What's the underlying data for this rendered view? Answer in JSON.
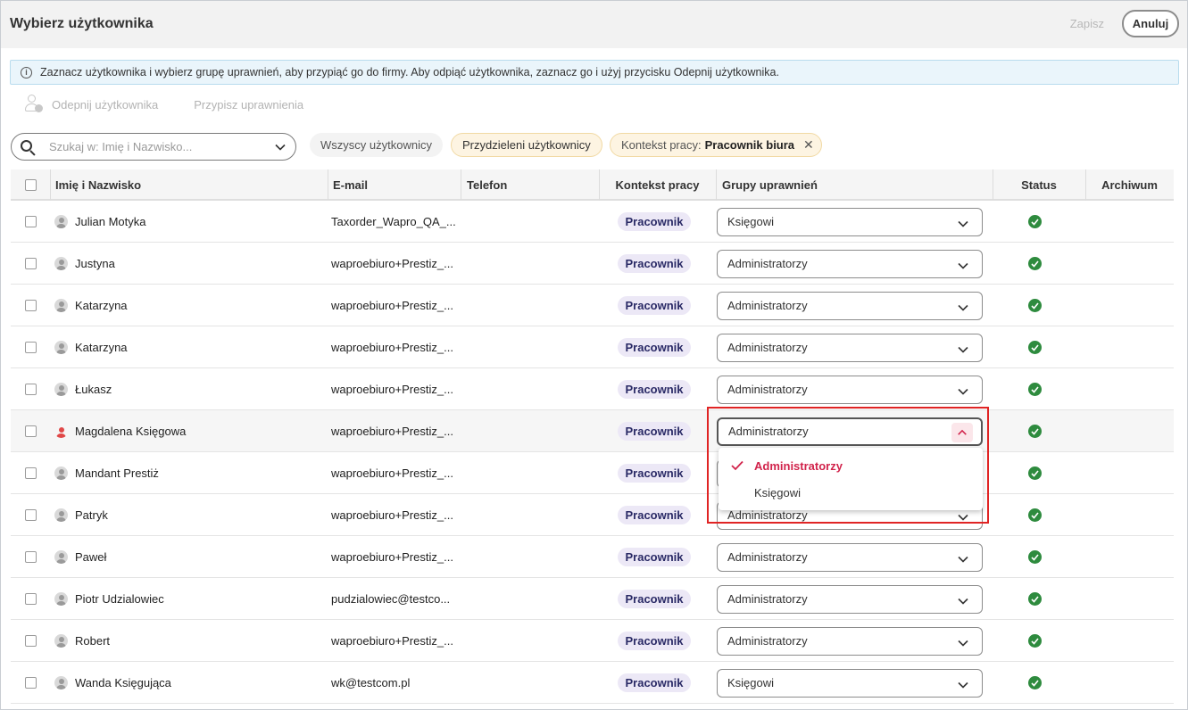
{
  "header": {
    "title": "Wybierz użytkownika",
    "save_label": "Zapisz",
    "cancel_label": "Anuluj"
  },
  "info": {
    "text": "Zaznacz użytkownika i wybierz grupę uprawnień, aby przypiąć go do firmy. Aby odpiąć użytkownika, zaznacz go i użyj przycisku Odepnij użytkownika."
  },
  "actions": {
    "unlink_label": "Odepnij użytkownika",
    "assign_label": "Przypisz uprawnienia"
  },
  "search": {
    "placeholder": "Szukaj w: Imię i Nazwisko..."
  },
  "filters": {
    "all_label": "Wszyscy użytkownicy",
    "assigned_label": "Przydzieleni użytkownicy",
    "context_prefix": "Kontekst pracy:",
    "context_value": "Pracownik biura"
  },
  "columns": {
    "name": "Imię i Nazwisko",
    "email": "E-mail",
    "phone": "Telefon",
    "context": "Kontekst pracy",
    "groups": "Grupy uprawnień",
    "status": "Status",
    "archive": "Archiwum"
  },
  "rows": [
    {
      "name": "Julian Motyka",
      "email": "Taxorder_Wapro_QA_...",
      "phone": "",
      "context": "Pracownik",
      "group": "Księgowi",
      "avatar": "gray"
    },
    {
      "name": "Justyna",
      "email": "waproebiuro+Prestiz_...",
      "phone": "",
      "context": "Pracownik",
      "group": "Administratorzy",
      "avatar": "gray"
    },
    {
      "name": "Katarzyna",
      "email": "waproebiuro+Prestiz_...",
      "phone": "",
      "context": "Pracownik",
      "group": "Administratorzy",
      "avatar": "gray"
    },
    {
      "name": "Katarzyna",
      "email": "waproebiuro+Prestiz_...",
      "phone": "",
      "context": "Pracownik",
      "group": "Administratorzy",
      "avatar": "gray"
    },
    {
      "name": "Łukasz",
      "email": "waproebiuro+Prestiz_...",
      "phone": "",
      "context": "Pracownik",
      "group": "Administratorzy",
      "avatar": "gray"
    },
    {
      "name": "Magdalena Księgowa",
      "email": "waproebiuro+Prestiz_...",
      "phone": "",
      "context": "Pracownik",
      "group": "Administratorzy",
      "avatar": "red",
      "open": true
    },
    {
      "name": "Mandant Prestiż",
      "email": "waproebiuro+Prestiz_...",
      "phone": "",
      "context": "Pracownik",
      "group": "Administratorzy",
      "avatar": "gray"
    },
    {
      "name": "Patryk",
      "email": "waproebiuro+Prestiz_...",
      "phone": "",
      "context": "Pracownik",
      "group": "Administratorzy",
      "avatar": "gray"
    },
    {
      "name": "Paweł",
      "email": "waproebiuro+Prestiz_...",
      "phone": "",
      "context": "Pracownik",
      "group": "Administratorzy",
      "avatar": "gray"
    },
    {
      "name": "Piotr Udzialowiec",
      "email": "pudzialowiec@testco...",
      "phone": "",
      "context": "Pracownik",
      "group": "Administratorzy",
      "avatar": "gray"
    },
    {
      "name": "Robert",
      "email": "waproebiuro+Prestiz_...",
      "phone": "",
      "context": "Pracownik",
      "group": "Administratorzy",
      "avatar": "gray"
    },
    {
      "name": "Wanda Księgująca",
      "email": "wk@testcom.pl",
      "phone": "",
      "context": "Pracownik",
      "group": "Księgowi",
      "avatar": "gray"
    }
  ],
  "dropdown": {
    "options": [
      "Administratorzy",
      "Księgowi"
    ],
    "selected": "Administratorzy"
  },
  "colors": {
    "accent": "#d1234b",
    "status_ok": "#2e8b3e",
    "pill_bg": "#ece8f6",
    "chip_bg": "#fdf4e2",
    "highlight_box": "#e02424"
  }
}
